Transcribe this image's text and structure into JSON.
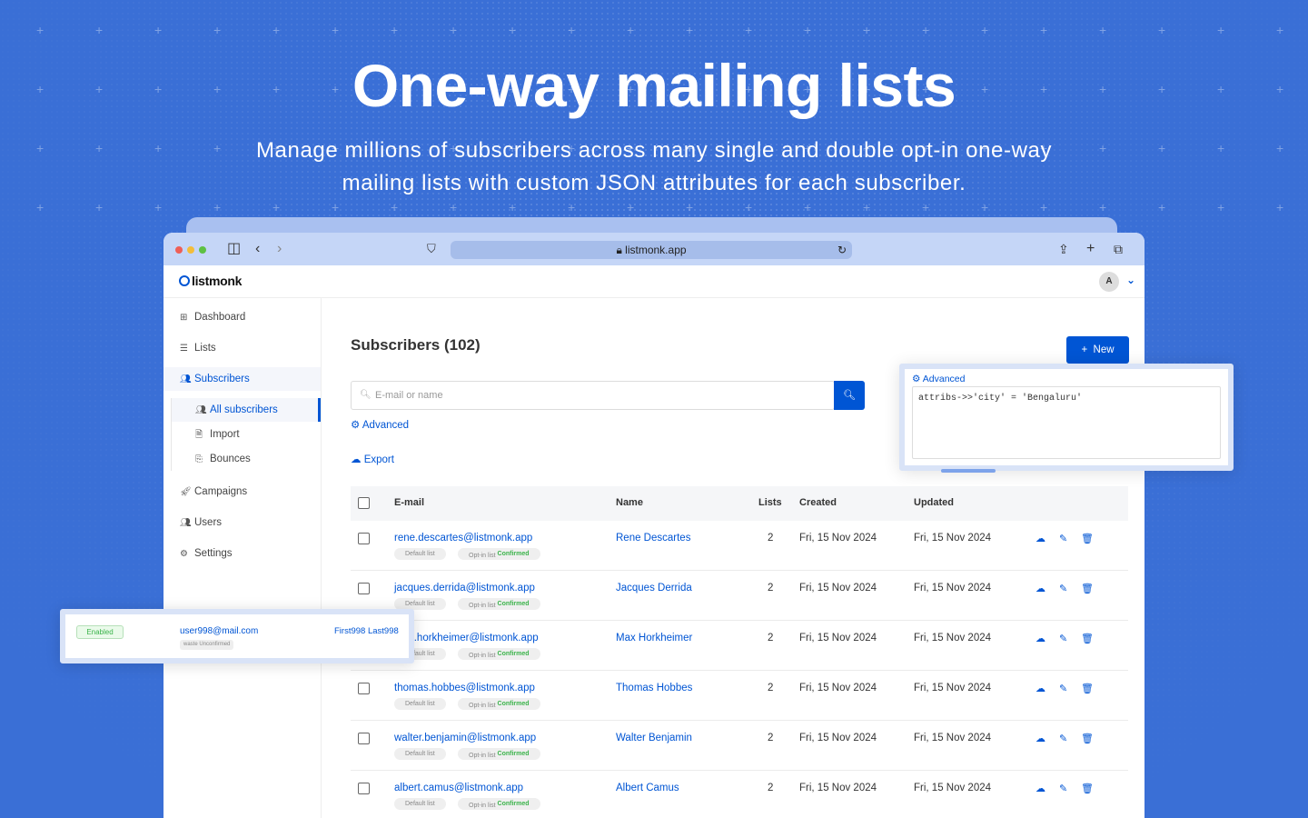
{
  "hero": {
    "title": "One-way mailing lists",
    "subtitle": "Manage millions of subscribers across many single and double opt-in one-way mailing lists with custom JSON attributes for each subscriber."
  },
  "browser": {
    "url": "listmonk.app"
  },
  "app": {
    "logo": "listmonk",
    "avatar": "A"
  },
  "sidebar": {
    "items": [
      {
        "label": "Dashboard",
        "icon": "dashboard-icon"
      },
      {
        "label": "Lists",
        "icon": "list-icon"
      },
      {
        "label": "Subscribers",
        "icon": "users-icon"
      },
      {
        "label": "Campaigns",
        "icon": "rocket-icon"
      },
      {
        "label": "Users",
        "icon": "users-icon"
      },
      {
        "label": "Settings",
        "icon": "gear-icon"
      }
    ],
    "subitems": [
      {
        "label": "All subscribers",
        "icon": "users-icon"
      },
      {
        "label": "Import",
        "icon": "file-icon"
      },
      {
        "label": "Bounces",
        "icon": "bounce-icon"
      }
    ]
  },
  "main": {
    "title": "Subscribers (102)",
    "new_button": "New",
    "search_placeholder": "E-mail or name",
    "advanced": "Advanced",
    "export": "Export",
    "columns": {
      "email": "E-mail",
      "name": "Name",
      "lists": "Lists",
      "created": "Created",
      "updated": "Updated"
    },
    "rows": [
      {
        "email": "rene.descartes@listmonk.app",
        "name": "Rene Descartes",
        "lists": "2",
        "created": "Fri, 15 Nov 2024",
        "updated": "Fri, 15 Nov 2024",
        "tag1": "Default list",
        "tag2": "Opt-in list",
        "tag2_status": "Confirmed"
      },
      {
        "email": "jacques.derrida@listmonk.app",
        "name": "Jacques Derrida",
        "lists": "2",
        "created": "Fri, 15 Nov 2024",
        "updated": "Fri, 15 Nov 2024",
        "tag1": "Default list",
        "tag2": "Opt-in list",
        "tag2_status": "Confirmed"
      },
      {
        "email": "max.horkheimer@listmonk.app",
        "name": "Max Horkheimer",
        "lists": "2",
        "created": "Fri, 15 Nov 2024",
        "updated": "Fri, 15 Nov 2024",
        "tag1": "Default list",
        "tag2": "Opt-in list",
        "tag2_status": "Confirmed"
      },
      {
        "email": "thomas.hobbes@listmonk.app",
        "name": "Thomas Hobbes",
        "lists": "2",
        "created": "Fri, 15 Nov 2024",
        "updated": "Fri, 15 Nov 2024",
        "tag1": "Default list",
        "tag2": "Opt-in list",
        "tag2_status": "Confirmed"
      },
      {
        "email": "walter.benjamin@listmonk.app",
        "name": "Walter Benjamin",
        "lists": "2",
        "created": "Fri, 15 Nov 2024",
        "updated": "Fri, 15 Nov 2024",
        "tag1": "Default list",
        "tag2": "Opt-in list",
        "tag2_status": "Confirmed"
      },
      {
        "email": "albert.camus@listmonk.app",
        "name": "Albert Camus",
        "lists": "2",
        "created": "Fri, 15 Nov 2024",
        "updated": "Fri, 15 Nov 2024",
        "tag1": "Default list",
        "tag2": "Opt-in list",
        "tag2_status": "Confirmed"
      }
    ]
  },
  "advanced_panel": {
    "label": "Advanced",
    "query": "attribs->>'city' = 'Bengaluru'"
  },
  "floating_subscriber": {
    "status": "Enabled",
    "email": "user998@mail.com",
    "name": "First998 Last998",
    "tag": "waste",
    "tag_status": "Unconfirmed"
  },
  "colors": {
    "background": "#3a6fd6",
    "accent": "#0055d4",
    "confirmed": "#3ab34a"
  }
}
